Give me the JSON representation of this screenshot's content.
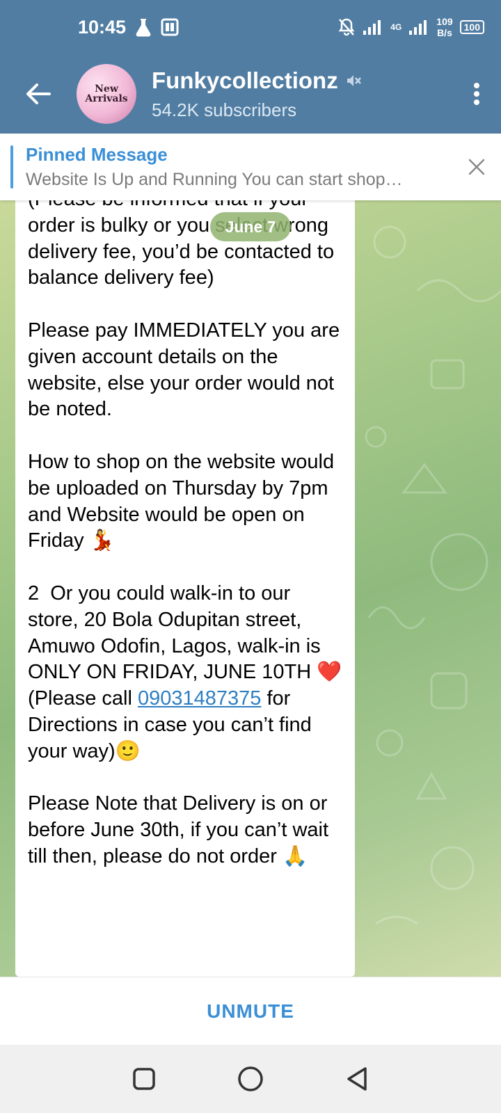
{
  "status_bar": {
    "time": "10:45",
    "net_speed_value": "109",
    "net_speed_unit": "B/s",
    "battery": "100",
    "network": "4G"
  },
  "header": {
    "channel_title": "Funkycollectionz",
    "subscribers": "54.2K subscribers",
    "avatar_text_line1": "New",
    "avatar_text_line2": "Arrivals"
  },
  "pinned": {
    "title": "Pinned Message",
    "preview": "Website Is Up and Running  You can start shop…"
  },
  "chat": {
    "date_pill": "June 7",
    "message": {
      "part1": "(Please be informed that if your order is bulky or you select wrong delivery fee, you’d be contacted to balance delivery fee)\n\nPlease pay IMMEDIATELY you are given account details on the website, else your order would not be noted.\n\nHow to shop on the website would be uploaded on Thursday by 7pm and Website would be open on Friday 💃\n\n2  Or you could walk-in to our store, 20 Bola Odupitan street, Amuwo Odofin, Lagos, walk-in is ONLY ON FRIDAY, JUNE 10TH ❤️\n(Please call ",
      "phone": "09031487375",
      "part2": " for Directions in case you can’t find your way)🙂\n\nPlease Note that Delivery is on or before June 30th, if you can’t wait till then, please do not order 🙏"
    }
  },
  "bottom": {
    "unmute_label": "UNMUTE"
  },
  "colors": {
    "header_bg": "#517DA2",
    "accent": "#3A8FD6",
    "link": "#2E7FC2"
  },
  "icons": {
    "status": [
      "flask-icon",
      "sim-card-icon",
      "notifications-off-icon",
      "signal-icon",
      "signal-icon",
      "battery-icon"
    ],
    "header": [
      "back-arrow-icon",
      "muted-speaker-icon",
      "more-vertical-icon"
    ],
    "pinned": [
      "close-icon"
    ],
    "nav": [
      "recent-apps-icon",
      "home-icon",
      "back-triangle-icon"
    ]
  }
}
